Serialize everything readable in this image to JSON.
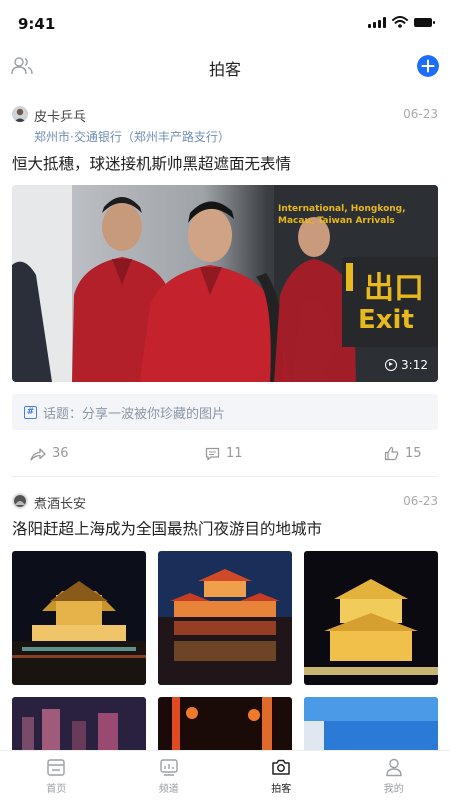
{
  "status_bar": {
    "time": "9:41"
  },
  "nav": {
    "title": "拍客"
  },
  "posts": [
    {
      "author": "皮卡乒乓",
      "date": "06-23",
      "location": "郑州市·交通银行（郑州丰产路支行）",
      "title": "恒大抵穗，球迷接机斯帅黑超遮面无表情",
      "video": {
        "duration": "3:12",
        "sign_cn": "出口",
        "sign_en": "Exit",
        "sign_sub": "International, Hongkong, Macau, Taiwan Arrivals"
      },
      "topic": "话题：分享一波被你珍藏的图片",
      "shares": "36",
      "comments": "11",
      "likes": "15"
    },
    {
      "author": "煮酒长安",
      "date": "06-23",
      "title": "洛阳赶超上海成为全国最热门夜游目的地城市"
    }
  ],
  "tabs": [
    {
      "label": "首页",
      "icon": "home-icon"
    },
    {
      "label": "频道",
      "icon": "channel-icon"
    },
    {
      "label": "拍客",
      "icon": "camera-icon",
      "active": true
    },
    {
      "label": "我的",
      "icon": "profile-icon"
    }
  ],
  "colors": {
    "accent": "#1e6dfa",
    "location": "#6f8fb5",
    "muted": "#999999"
  }
}
